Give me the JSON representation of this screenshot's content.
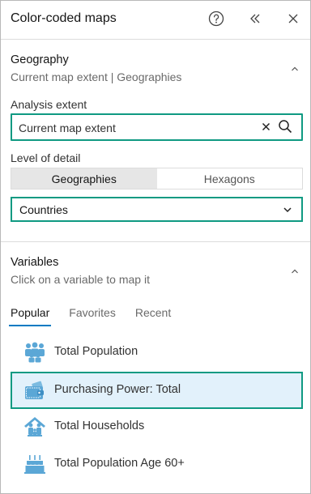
{
  "header": {
    "title": "Color-coded maps"
  },
  "geography": {
    "title": "Geography",
    "subtitle": "Current map extent | Geographies"
  },
  "analysis_extent": {
    "label": "Analysis extent",
    "value": "Current map extent"
  },
  "level_of_detail": {
    "label": "Level of detail",
    "options": [
      "Geographies",
      "Hexagons"
    ],
    "selected": "Geographies"
  },
  "boundary_select": {
    "value": "Countries"
  },
  "variables": {
    "title": "Variables",
    "subtitle": "Click on a variable to map it",
    "tabs": [
      "Popular",
      "Favorites",
      "Recent"
    ],
    "active_tab": "Popular",
    "items": [
      {
        "label": "Total Population",
        "icon": "people-icon"
      },
      {
        "label": "Purchasing Power: Total",
        "icon": "wallet-icon",
        "selected": true
      },
      {
        "label": "Total Households",
        "icon": "household-icon"
      },
      {
        "label": "Total Population Age 60+",
        "icon": "birthday-cake-icon"
      }
    ]
  },
  "colors": {
    "accent_border": "#0f9a82",
    "icon_blue": "#5ba7d6",
    "selected_bg": "#e2f1fb",
    "tab_underline": "#007ac2"
  }
}
